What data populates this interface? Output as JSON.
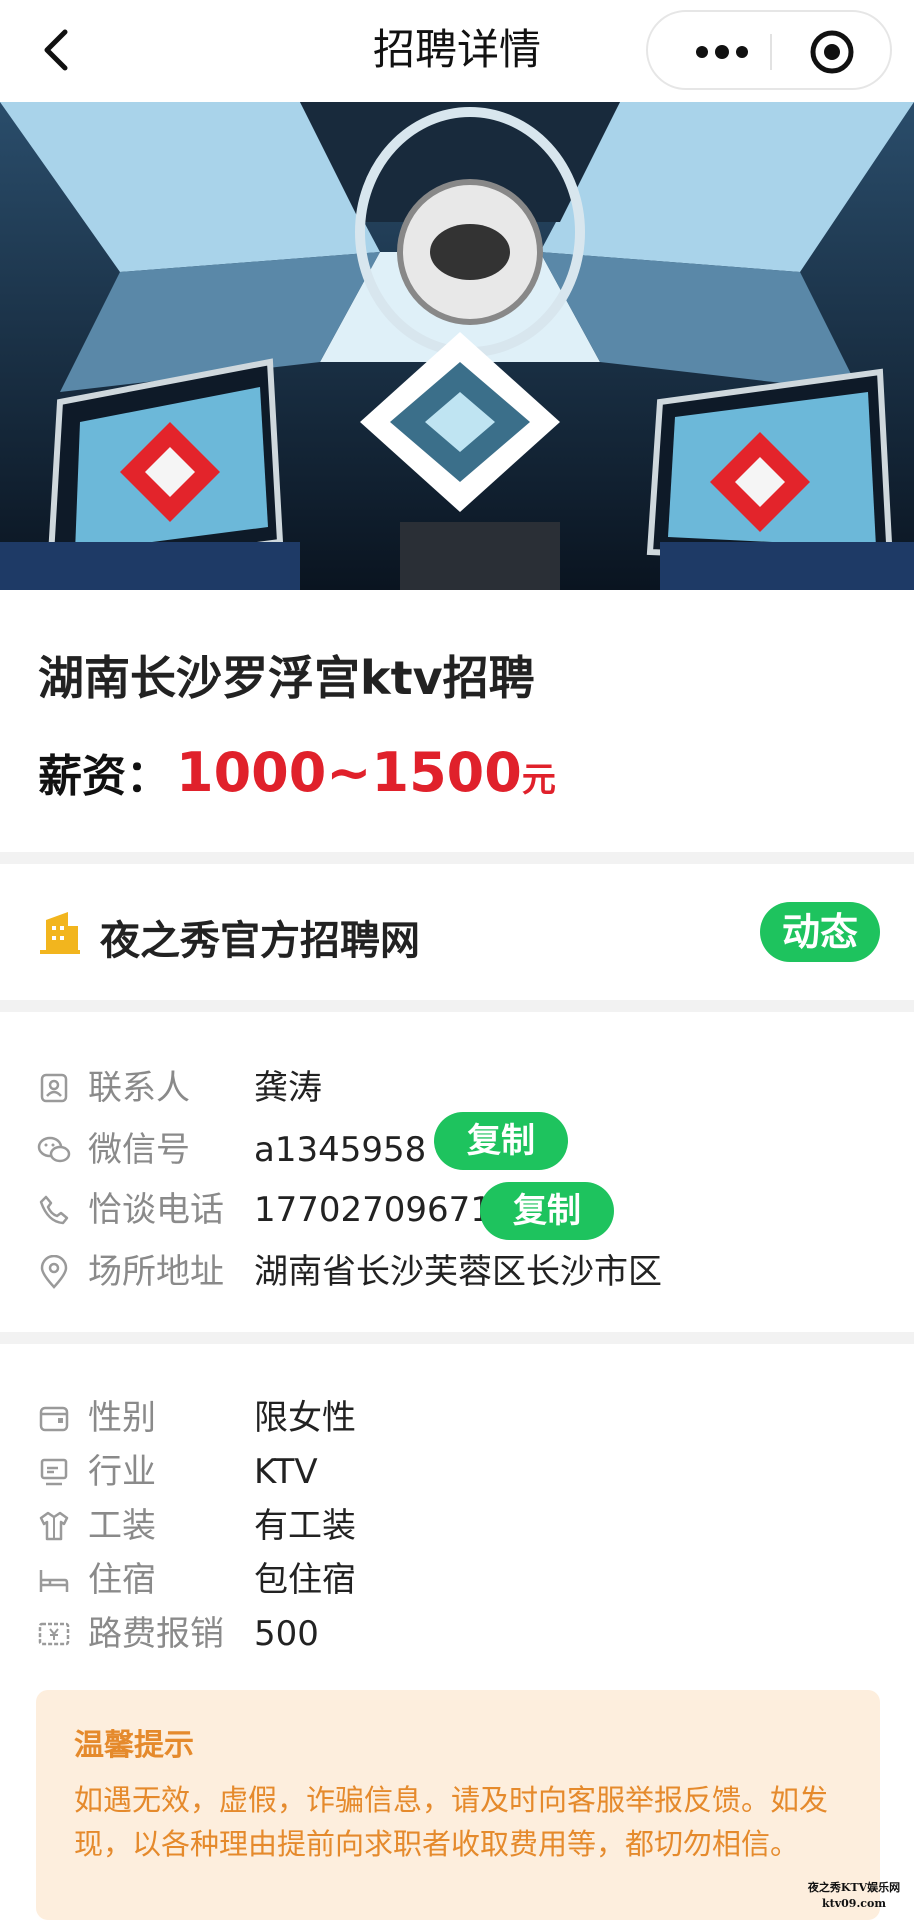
{
  "nav": {
    "title": "招聘详情"
  },
  "job": {
    "title": "湖南长沙罗浮宫ktv招聘",
    "salary_label": "薪资：",
    "salary_value": "1000~1500",
    "salary_unit": "元"
  },
  "company": {
    "name": "夜之秀官方招聘网",
    "dynamic_button": "动态"
  },
  "contact": [
    {
      "label": "联系人",
      "value": "龚涛",
      "icon": "contact-icon"
    },
    {
      "label": "微信号",
      "value": "a1345958",
      "icon": "wechat-icon",
      "action": "复制"
    },
    {
      "label": "恰谈电话",
      "value": "17702709671",
      "icon": "phone-icon",
      "action": "复制"
    },
    {
      "label": "场所地址",
      "value": "湖南省长沙芙蓉区长沙市区",
      "icon": "location-icon"
    }
  ],
  "info": [
    {
      "label": "性别",
      "value": "限女性",
      "icon": "gender-icon"
    },
    {
      "label": "行业",
      "value": "KTV",
      "icon": "industry-icon"
    },
    {
      "label": "工装",
      "value": "有工装",
      "icon": "uniform-icon"
    },
    {
      "label": "住宿",
      "value": "包住宿",
      "icon": "bed-icon"
    },
    {
      "label": "路费报销",
      "value": "500",
      "icon": "money-icon"
    }
  ],
  "tip": {
    "title": "温馨提示",
    "text": "如遇无效，虚假，诈骗信息，请及时向客服举报反馈。如发现，以各种理由提前向求职者收取费用等，都切勿相信。"
  },
  "watermark": {
    "line1": "夜之秀KTV娱乐网",
    "line2": "ktv09.com"
  },
  "colors": {
    "accent_green": "#1ec35e",
    "salary_red": "#e0212b",
    "tip_orange": "#e58a2c",
    "tip_bg": "#fdeedd"
  }
}
